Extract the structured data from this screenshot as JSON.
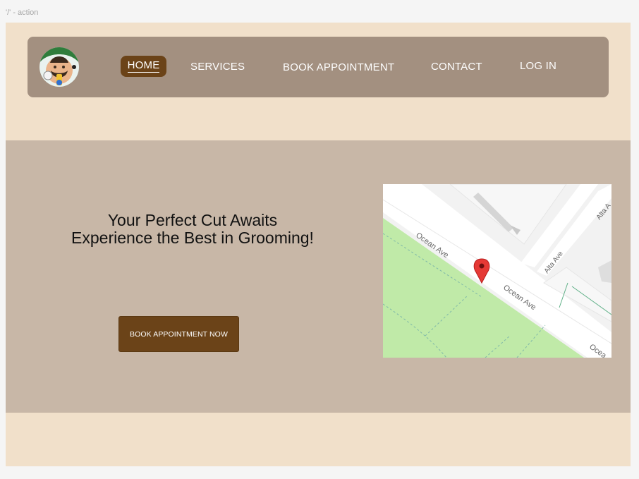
{
  "frame_label": "'/' - action",
  "nav": {
    "items": [
      {
        "label": "HOME",
        "active": true
      },
      {
        "label": "SERVICES"
      },
      {
        "label": "BOOK APPOINTMENT"
      },
      {
        "label": "CONTACT"
      },
      {
        "label": "LOG IN"
      }
    ]
  },
  "hero": {
    "headline_line1": "Your Perfect Cut Awaits",
    "headline_line2": "Experience the Best in Grooming!",
    "cta_label": "BOOK APPOINTMENT NOW"
  },
  "map": {
    "streets": [
      "Ocean Ave",
      "Ocean Ave",
      "Alta Ave",
      "Alta A",
      "Ocea"
    ],
    "marker_icon": "map-pin-icon"
  },
  "colors": {
    "page_bg": "#f1e0ca",
    "nav_bg": "#a39080",
    "hero_bg": "#c8b7a7",
    "accent_brown": "#6b4318",
    "map_park": "#c0eaa8",
    "map_road": "#ffffff",
    "marker_red": "#e53935"
  }
}
